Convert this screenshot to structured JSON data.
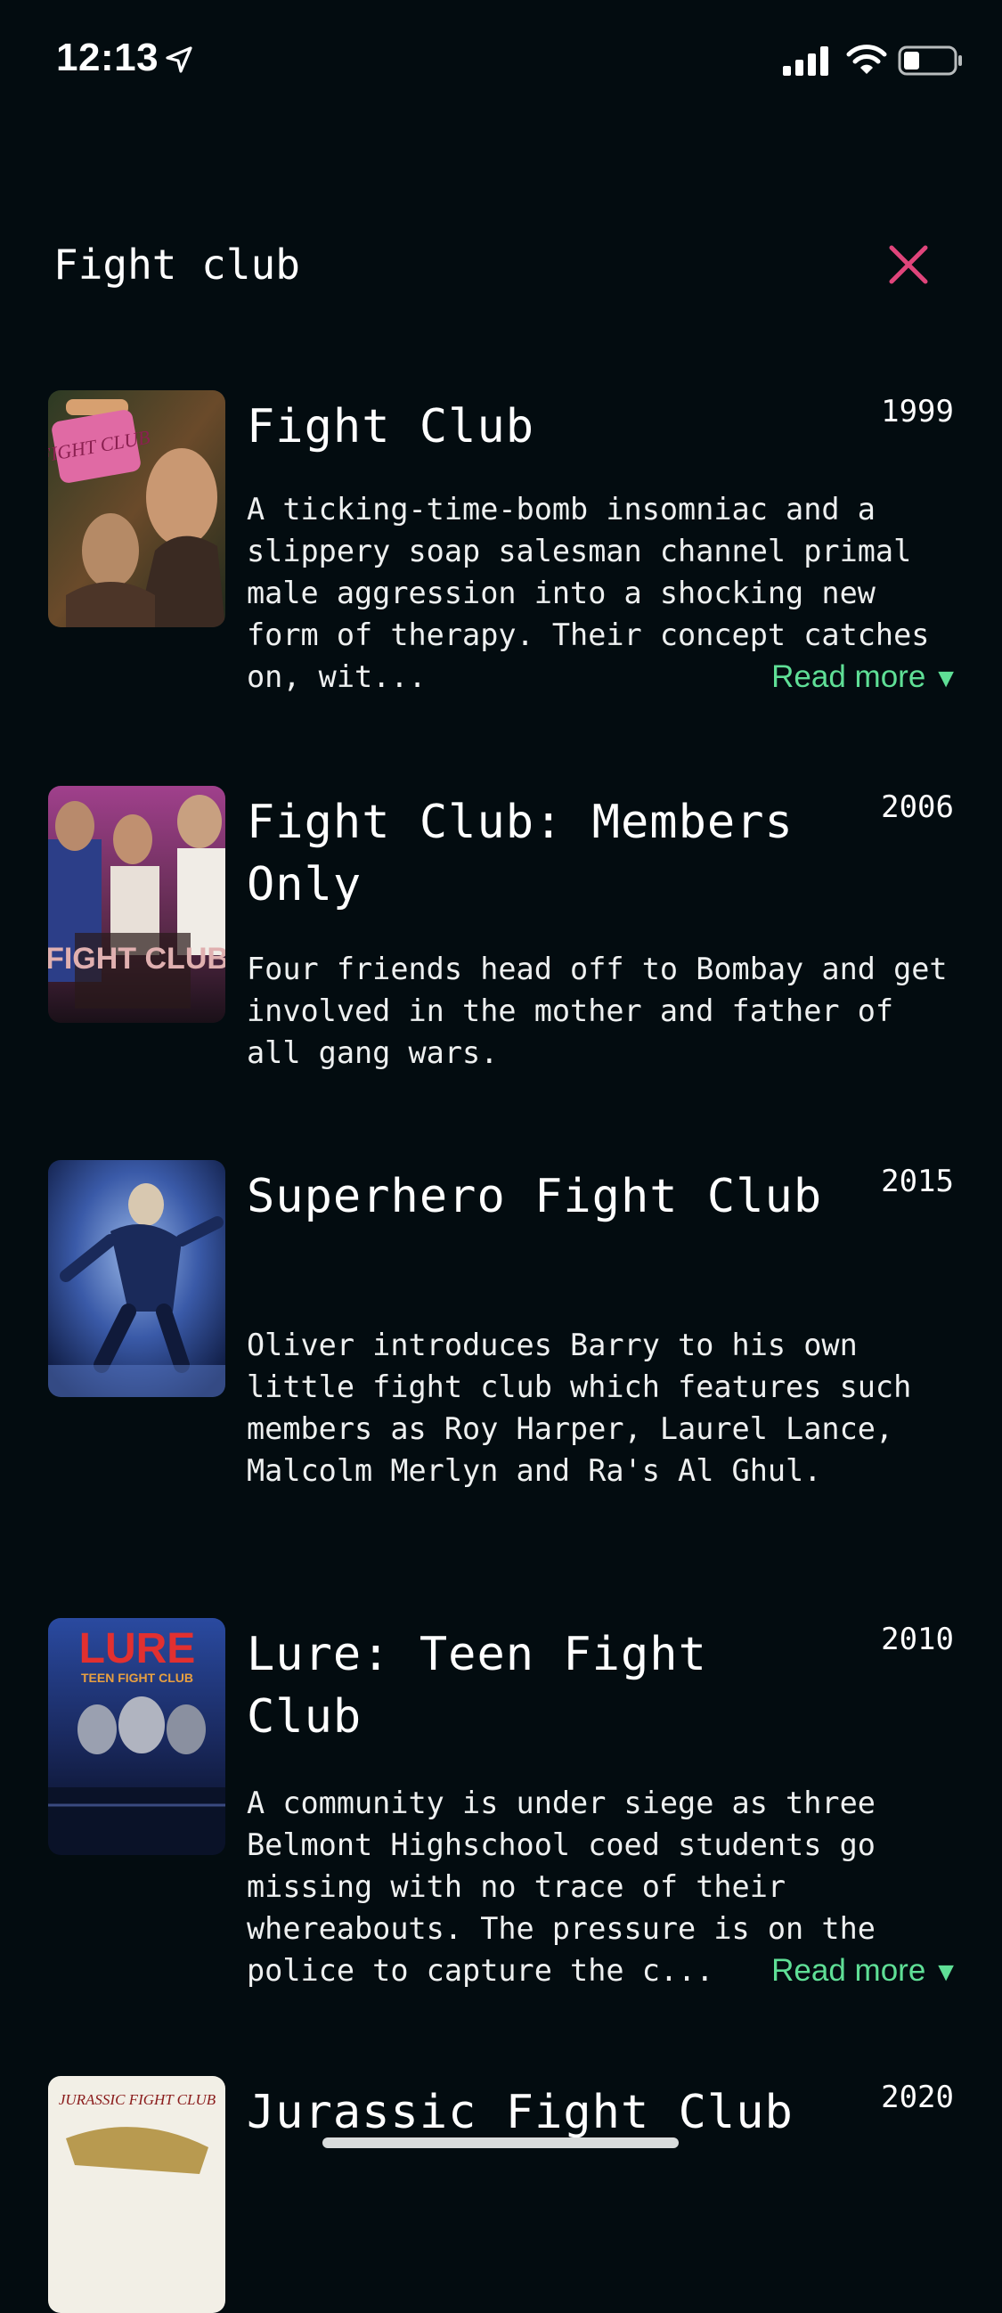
{
  "status_bar": {
    "time": "12:13"
  },
  "search": {
    "query": "Fight club",
    "placeholder": ""
  },
  "results": [
    {
      "title": "Fight Club",
      "year": "1999",
      "description": "A ticking-time-bomb insomniac and a slippery soap salesman channel primal male aggression into a shocking new form of therapy. Their concept catches on, wit...",
      "read_more": "Read more",
      "poster_text": "FIGHT CLUB"
    },
    {
      "title": "Fight Club: Members Only",
      "year": "2006",
      "description": "Four friends head off to Bombay and get involved in the mother and father of all gang wars.",
      "poster_text": "FIGHT CLUB"
    },
    {
      "title": "Superhero Fight Club",
      "year": "2015",
      "description": "Oliver introduces Barry to his own little fight club which features such members as Roy Harper, Laurel Lance, Malcolm Merlyn and Ra's Al Ghul."
    },
    {
      "title": "Lure: Teen Fight Club",
      "year": "2010",
      "description": "A community is under siege as three Belmont Highschool coed students go missing with no trace of their whereabouts. The pressure is on the police to capture the c...",
      "read_more": "Read more",
      "poster_text": "LURE",
      "poster_subtext": "TEEN FIGHT CLUB"
    },
    {
      "title": "Jurassic Fight Club",
      "year": "2020",
      "poster_text": "JURASSIC FIGHT CLUB"
    }
  ],
  "colors": {
    "background": "#030c10",
    "accent_close": "#e0457b",
    "read_more": "#5fdf96"
  },
  "icons": [
    "location-arrow-icon",
    "cellular-signal-icon",
    "wifi-icon",
    "battery-icon",
    "close-icon",
    "caret-down-icon"
  ]
}
